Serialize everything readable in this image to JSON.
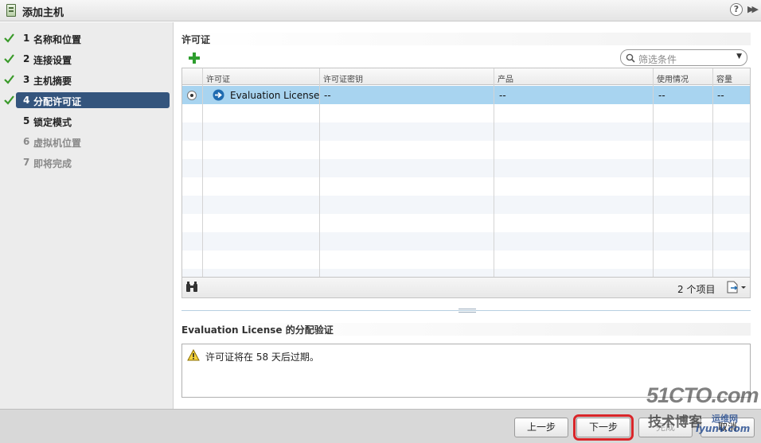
{
  "window": {
    "title": "添加主机",
    "help_glyph": "?"
  },
  "nav": {
    "steps": [
      {
        "num": "1",
        "label": "名称和位置",
        "state": "done"
      },
      {
        "num": "2",
        "label": "连接设置",
        "state": "done"
      },
      {
        "num": "3",
        "label": "主机摘要",
        "state": "done"
      },
      {
        "num": "4",
        "label": "分配许可证",
        "state": "active"
      },
      {
        "num": "5",
        "label": "锁定模式",
        "state": "pending"
      },
      {
        "num": "6",
        "label": "虚拟机位置",
        "state": "disabled"
      },
      {
        "num": "7",
        "label": "即将完成",
        "state": "disabled"
      }
    ]
  },
  "license_section": {
    "title": "许可证",
    "filter_placeholder": "筛选条件",
    "columns": [
      "许可证",
      "许可证密钥",
      "产品",
      "使用情况",
      "容量"
    ],
    "rows": [
      {
        "license": "Evaluation License",
        "key": "--",
        "product": "--",
        "usage": "--",
        "capacity": "--",
        "selected": true
      }
    ],
    "item_count": "2 个项目"
  },
  "validation": {
    "title": "Evaluation License 的分配验证",
    "message": "许可证将在 58 天后过期。"
  },
  "footer": {
    "back": "上一步",
    "next": "下一步",
    "finish": "完成",
    "cancel": "取消"
  },
  "watermark": {
    "site": "51CTO.com",
    "blog": "技术博客",
    "ops": "运维网",
    "domain": "iyunv.com"
  },
  "colors": {
    "active_step": "#34557d",
    "selected_row": "#a8d4f0",
    "check": "#3a9a2a",
    "highlight_outline": "#d9262a"
  }
}
